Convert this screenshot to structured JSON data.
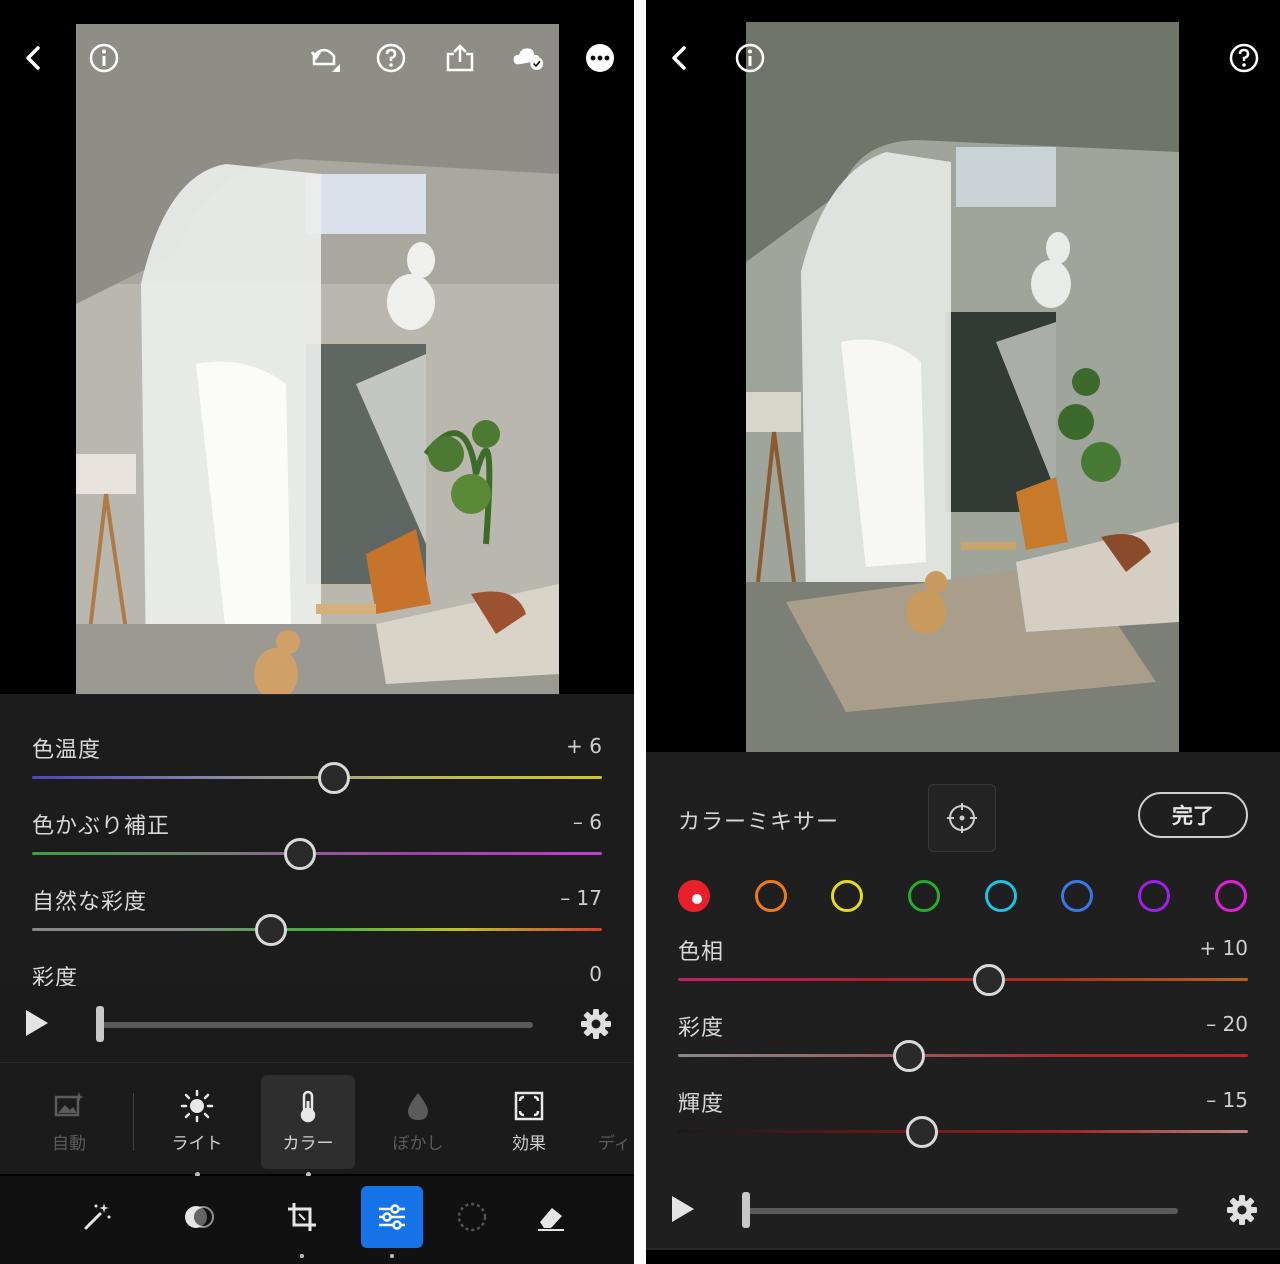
{
  "left_screen": {
    "sliders": [
      {
        "label": "色温度",
        "value": "+ 6",
        "position": 0.53,
        "gradient": [
          "#4a4ab0",
          "#8888a8",
          "#b8b860",
          "#d0c530"
        ]
      },
      {
        "label": "色かぶり補正",
        "value": "– 6",
        "position": 0.47,
        "gradient": [
          "#3aa040",
          "#7a7a7a",
          "#a040b0",
          "#c040d0"
        ]
      },
      {
        "label": "自然な彩度",
        "value": "– 17",
        "position": 0.42,
        "gradient": [
          "#888888",
          "#888888",
          "#40b040",
          "#c0c030",
          "#d04030"
        ]
      },
      {
        "label": "彩度",
        "value": "0"
      }
    ],
    "playback": {
      "position": 0.0
    },
    "tool_tabs": [
      {
        "label": "自動",
        "icon": "auto-image-icon",
        "state": "disabled"
      },
      {
        "label": "ライト",
        "icon": "sun-icon",
        "state": "normal"
      },
      {
        "label": "カラー",
        "icon": "thermometer-icon",
        "state": "selected"
      },
      {
        "label": "ぼかし",
        "icon": "droplet-icon",
        "state": "disabled"
      },
      {
        "label": "効果",
        "icon": "effects-icon",
        "state": "normal"
      },
      {
        "label": "ディ",
        "icon": "",
        "state": "disabled"
      }
    ],
    "bottom_tools": [
      "magic-wand-icon",
      "healing-icon",
      "crop-icon",
      "adjust-sliders-icon",
      "masking-icon",
      "eraser-icon"
    ],
    "active_bottom_tool": "adjust-sliders-icon"
  },
  "right_screen": {
    "mixer": {
      "title": "カラーミキサー",
      "done_label": "完了",
      "swatches": [
        {
          "name": "red",
          "color": "#e8202a",
          "selected": true
        },
        {
          "name": "orange",
          "color": "#f07a18",
          "selected": false
        },
        {
          "name": "yellow",
          "color": "#e8d820",
          "selected": false
        },
        {
          "name": "green",
          "color": "#2aa830",
          "selected": false
        },
        {
          "name": "aqua",
          "color": "#1fc0e0",
          "selected": false
        },
        {
          "name": "blue",
          "color": "#3a78e8",
          "selected": false
        },
        {
          "name": "purple",
          "color": "#a020e8",
          "selected": false
        },
        {
          "name": "magenta",
          "color": "#e020d8",
          "selected": false
        }
      ],
      "sliders": [
        {
          "label": "色相",
          "value": "+ 10",
          "position": 0.545,
          "gradient": [
            "#c0206a",
            "#b02030",
            "#a83020",
            "#b86020"
          ]
        },
        {
          "label": "彩度",
          "value": "– 20",
          "position": 0.405,
          "gradient": [
            "#8a8a8a",
            "#9a6060",
            "#b02828",
            "#c02020"
          ]
        },
        {
          "label": "輝度",
          "value": "– 15",
          "position": 0.428,
          "gradient": [
            "#1a1a1a",
            "#601818",
            "#a02020",
            "#c08080"
          ]
        }
      ]
    },
    "playback": {
      "position": 0.0
    }
  }
}
